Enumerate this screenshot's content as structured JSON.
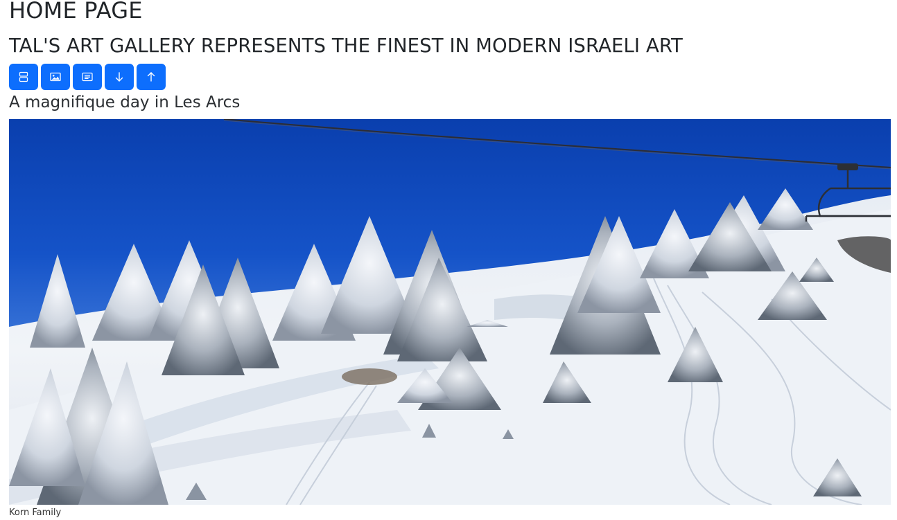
{
  "page": {
    "title": "HOME PAGE",
    "subtitle": "TAL'S ART GALLERY REPRESENTS THE FINEST IN MODERN ISRAELI ART"
  },
  "toolbar": {
    "buttons": [
      {
        "icon": "layout-rows-icon"
      },
      {
        "icon": "image-icon"
      },
      {
        "icon": "card-text-icon"
      },
      {
        "icon": "arrow-down-icon"
      },
      {
        "icon": "arrow-up-icon"
      }
    ],
    "accent_color": "#0d6efd"
  },
  "artwork": {
    "title": "A magnifique day in Les Arcs",
    "credit": "Korn Family",
    "image_icon": "snowy-mountain-photo"
  }
}
